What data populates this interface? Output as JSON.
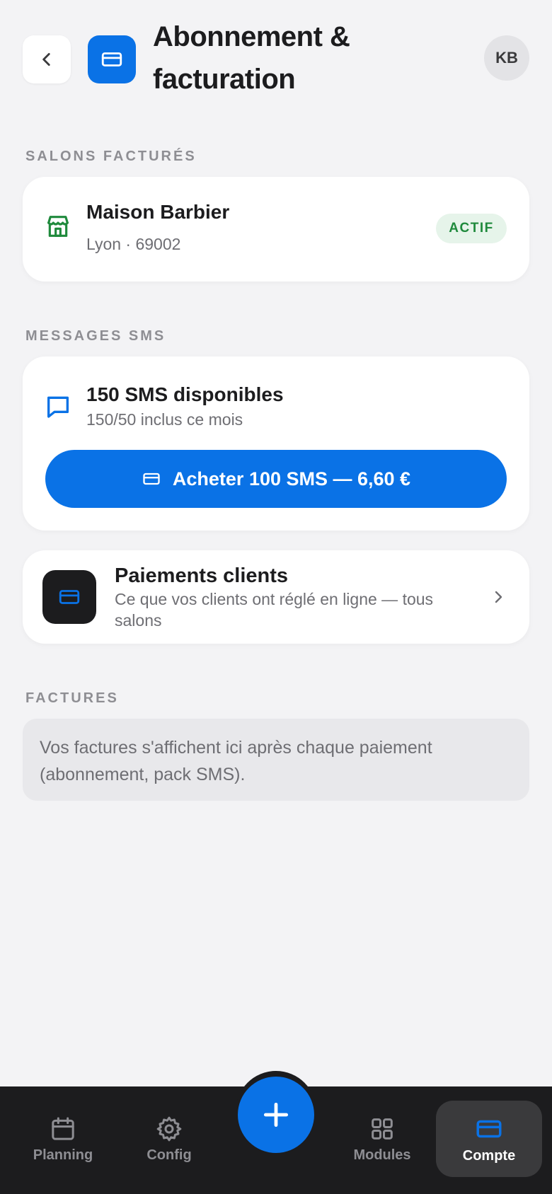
{
  "header": {
    "title": "Abonnement & facturation",
    "avatar_initials": "KB",
    "back_icon": "chevron-left-icon",
    "page_icon": "credit-card-icon"
  },
  "salons": {
    "section_label": "SALONS FACTURÉS",
    "items": [
      {
        "name": "Maison Barbier",
        "location": "Lyon · 69002",
        "status": "ACTIF",
        "icon": "store-icon"
      }
    ]
  },
  "sms": {
    "section_label": "MESSAGES SMS",
    "title": "150 SMS disponibles",
    "subtitle": "150/50 inclus ce mois",
    "buy_label": "Acheter 100 SMS — 6,60 €",
    "icon": "message-icon"
  },
  "payments": {
    "title": "Paiements clients",
    "subtitle": "Ce que vos clients ont réglé en ligne — tous salons",
    "icon": "credit-card-icon"
  },
  "invoices": {
    "section_label": "FACTURES",
    "empty_text": "Vos factures s'affichent ici après chaque paiement (abonnement, pack SMS)."
  },
  "tabbar": {
    "items": [
      {
        "label": "Planning",
        "icon": "calendar-icon",
        "active": false
      },
      {
        "label": "Config",
        "icon": "gear-icon",
        "active": false
      },
      {
        "label": "Modules",
        "icon": "grid-icon",
        "active": false
      },
      {
        "label": "Compte",
        "icon": "credit-card-icon",
        "active": true
      }
    ],
    "fab_icon": "plus-icon"
  },
  "colors": {
    "accent": "#0a72e6",
    "background": "#f3f3f5",
    "status_active_bg": "#e6f4ea",
    "status_active_text": "#1f8a3c",
    "tabbar_bg": "#1c1c1e"
  }
}
